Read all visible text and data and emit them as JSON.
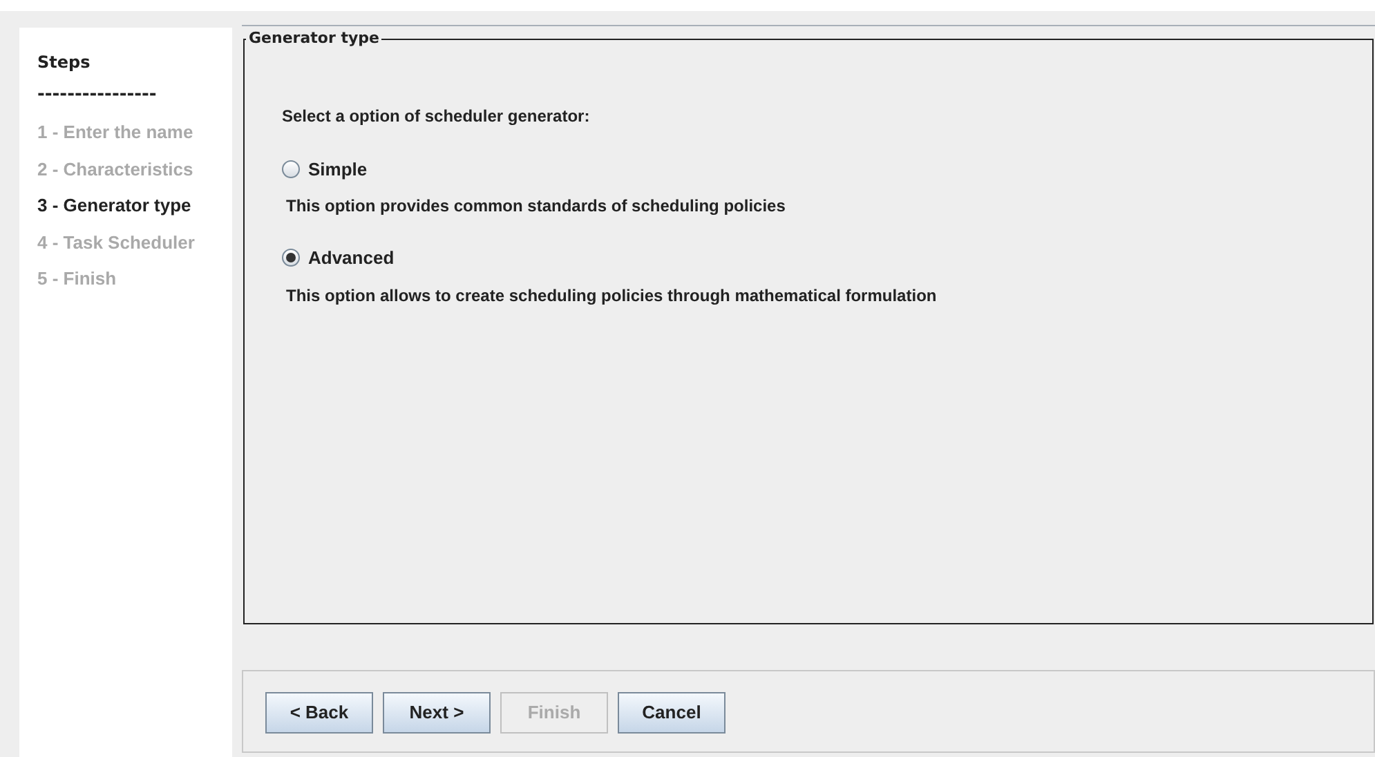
{
  "steps": {
    "title": "Steps",
    "separator": "----------------",
    "items": [
      {
        "label": "1 - Enter the name",
        "selected": false
      },
      {
        "label": "2 - Characteristics",
        "selected": false
      },
      {
        "label": "3 - Generator type",
        "selected": true
      },
      {
        "label": "4 - Task Scheduler",
        "selected": false
      },
      {
        "label": "5 - Finish",
        "selected": false
      }
    ]
  },
  "panel": {
    "title": "Generator type",
    "prompt": "Select a option of scheduler generator:",
    "options": [
      {
        "label": "Simple",
        "description": "This option provides common standards of scheduling policies",
        "selected": false
      },
      {
        "label": "Advanced",
        "description": "This option allows to create scheduling policies through mathematical formulation",
        "selected": true
      }
    ]
  },
  "buttons": [
    {
      "label": "< Back",
      "disabled": false
    },
    {
      "label": "Next >",
      "disabled": false
    },
    {
      "label": "Finish",
      "disabled": true
    },
    {
      "label": "Cancel",
      "disabled": false
    }
  ]
}
